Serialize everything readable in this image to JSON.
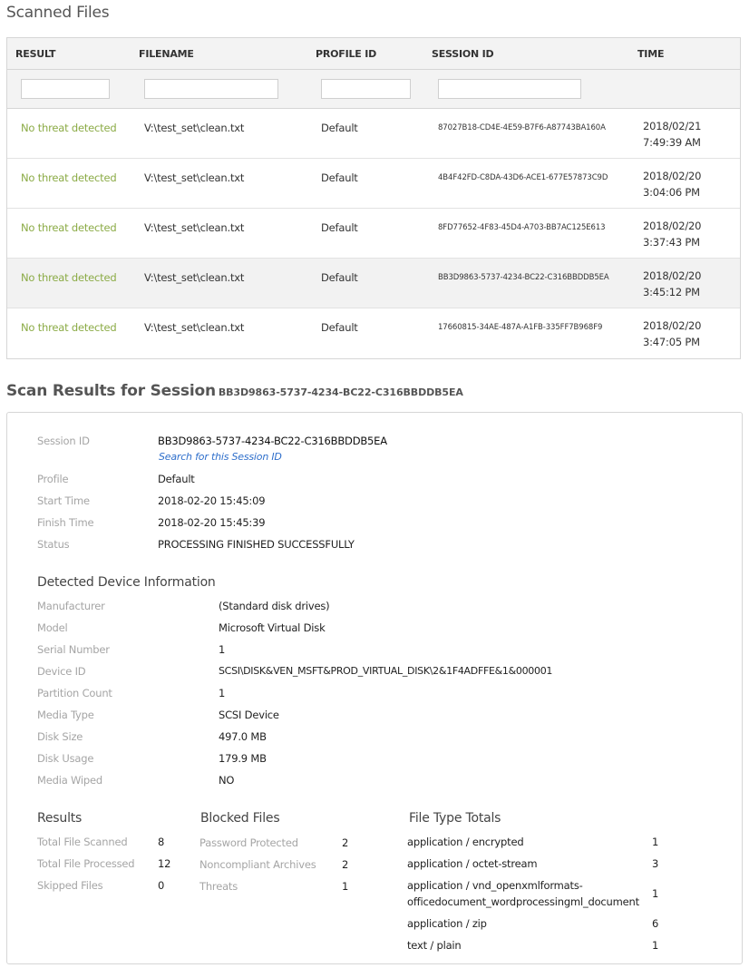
{
  "page_title": "Scanned Files",
  "table": {
    "headers": [
      "RESULT",
      "FILENAME",
      "PROFILE ID",
      "SESSION ID",
      "TIME"
    ],
    "rows": [
      {
        "result": "No threat detected",
        "filename": "V:\\test_set\\clean.txt",
        "profile": "Default",
        "session": "87027B18-CD4E-4E59-B7F6-A87743BA160A",
        "date": "2018/02/21",
        "time": "7:49:39 AM"
      },
      {
        "result": "No threat detected",
        "filename": "V:\\test_set\\clean.txt",
        "profile": "Default",
        "session": "4B4F42FD-C8DA-43D6-ACE1-677E57873C9D",
        "date": "2018/02/20",
        "time": "3:04:06 PM"
      },
      {
        "result": "No threat detected",
        "filename": "V:\\test_set\\clean.txt",
        "profile": "Default",
        "session": "8FD77652-4F83-45D4-A703-BB7AC125E613",
        "date": "2018/02/20",
        "time": "3:37:43 PM"
      },
      {
        "result": "No threat detected",
        "filename": "V:\\test_set\\clean.txt",
        "profile": "Default",
        "session": "BB3D9863-5737-4234-BC22-C316BBDDB5EA",
        "date": "2018/02/20",
        "time": "3:45:12 PM"
      },
      {
        "result": "No threat detected",
        "filename": "V:\\test_set\\clean.txt",
        "profile": "Default",
        "session": "17660815-34AE-487A-A1FB-335FF7B968F9",
        "date": "2018/02/20",
        "time": "3:47:05 PM"
      }
    ]
  },
  "session_section": {
    "title": "Scan Results for Session",
    "session_id": "BB3D9863-5737-4234-BC22-C316BBDDB5EA",
    "fields": {
      "session_id_label": "Session ID",
      "session_id_value": "BB3D9863-5737-4234-BC22-C316BBDDB5EA",
      "search_link": "Search for this Session ID",
      "profile_label": "Profile",
      "profile_value": "Default",
      "start_label": "Start Time",
      "start_value": "2018-02-20 15:45:09",
      "finish_label": "Finish Time",
      "finish_value": "2018-02-20 15:45:39",
      "status_label": "Status",
      "status_value": "PROCESSING FINISHED SUCCESSFULLY"
    },
    "device": {
      "heading": "Detected Device Information",
      "items": [
        {
          "label": "Manufacturer",
          "value": "(Standard disk drives)"
        },
        {
          "label": "Model",
          "value": "Microsoft Virtual Disk"
        },
        {
          "label": "Serial Number",
          "value": "1"
        },
        {
          "label": "Device ID",
          "value": "SCSI\\DISK&VEN_MSFT&PROD_VIRTUAL_DISK\\2&1F4ADFFE&1&000001"
        },
        {
          "label": "Partition Count",
          "value": "1"
        },
        {
          "label": "Media Type",
          "value": "SCSI Device"
        },
        {
          "label": "Disk Size",
          "value": "497.0 MB"
        },
        {
          "label": "Disk Usage",
          "value": "179.9 MB"
        },
        {
          "label": "Media Wiped",
          "value": "NO"
        }
      ]
    },
    "results": {
      "heading": "Results",
      "items": [
        {
          "label": "Total File Scanned",
          "value": "8"
        },
        {
          "label": "Total File Processed",
          "value": "12"
        },
        {
          "label": "Skipped Files",
          "value": "0"
        }
      ]
    },
    "blocked": {
      "heading": "Blocked Files",
      "items": [
        {
          "label": "Password Protected",
          "value": "2"
        },
        {
          "label": "Noncompliant Archives",
          "value": "2"
        },
        {
          "label": "Threats",
          "value": "1"
        }
      ]
    },
    "filetypes": {
      "heading": "File Type Totals",
      "items": [
        {
          "label": "application / encrypted",
          "value": "1"
        },
        {
          "label": "application / octet-stream",
          "value": "3"
        },
        {
          "label": "application / vnd_openxmlformats-",
          "label2": "officedocument_wordprocessingml_document",
          "value": "1"
        },
        {
          "label": "application / zip",
          "value": "6"
        },
        {
          "label": "text / plain",
          "value": "1"
        }
      ]
    }
  }
}
